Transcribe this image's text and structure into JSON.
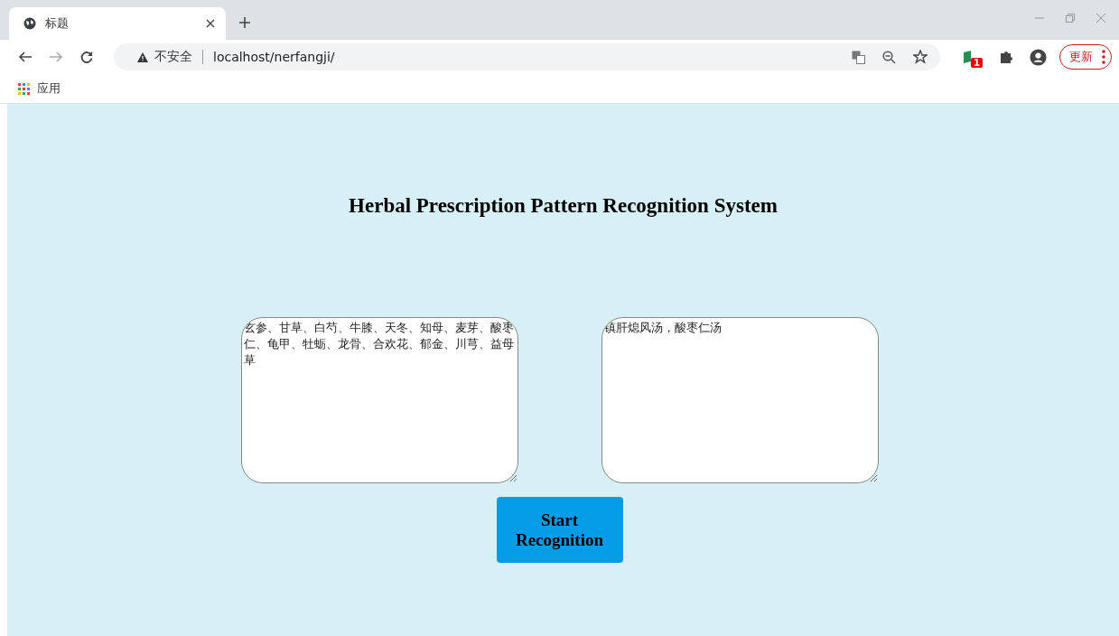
{
  "browser": {
    "tab": {
      "title": "标题",
      "selected": true
    },
    "address_bar": {
      "security": "不安全",
      "url": "localhost/nerfangji/"
    },
    "extension_badge": "1",
    "update_button": "更新",
    "bookmarks": [
      {
        "label": "应用"
      }
    ]
  },
  "page": {
    "heading": "Herbal Prescription Pattern Recognition System",
    "input_text": "玄参、甘草、白芍、牛膝、天冬、知母、麦芽、酸枣仁、龟甲、牡蛎、龙骨、合欢花、郁金、川芎、益母草",
    "result_text": "镇肝熄风汤，酸枣仁汤",
    "button": "Start Recognition"
  }
}
